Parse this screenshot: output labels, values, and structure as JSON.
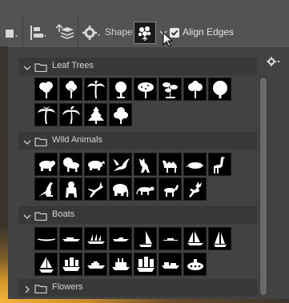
{
  "options_bar": {
    "shape_label": "Shape:",
    "align_edges_label": "Align Edges",
    "align_edges_checked": true,
    "selected_shape_icon": "flower-shape-icon",
    "tools": [
      "path-operations-icon",
      "path-alignment-icon",
      "path-arrangement-icon",
      "geometry-gear-icon"
    ]
  },
  "panel": {
    "settings_icon": "gear-icon",
    "groups": [
      {
        "name": "Leaf Trees",
        "expanded": true,
        "shapes": [
          "tree-1",
          "tree-2",
          "palm-tree",
          "tree-3",
          "tree-4",
          "bonsai-tree",
          "tree-5",
          "tree-6",
          "palm-tree-2",
          "palm-tree-3",
          "pine-tree",
          "tree-7"
        ]
      },
      {
        "name": "Wild Animals",
        "expanded": true,
        "shapes": [
          "bear",
          "lion",
          "rhino",
          "bird",
          "wolf",
          "camel",
          "mole",
          "giraffe",
          "kangaroo",
          "gorilla",
          "antelope",
          "elephant",
          "panther",
          "deer",
          "reindeer"
        ]
      },
      {
        "name": "Boats",
        "expanded": true,
        "shapes": [
          "canoe",
          "motorboat",
          "ship",
          "speedboat",
          "sailboat",
          "rowboat",
          "schooner",
          "sailboat-2",
          "sailboat-3",
          "galleon",
          "yacht",
          "steamboat",
          "tall-ship",
          "cargo-boat",
          "submarine"
        ]
      },
      {
        "name": "Flowers",
        "expanded": false,
        "shapes": []
      }
    ]
  },
  "colors": {
    "toolbar_bg": "#535353",
    "panel_bg": "#424242",
    "group_header_bg": "#383838",
    "tile_bg": "#000000",
    "shape_fill": "#ffffff"
  }
}
